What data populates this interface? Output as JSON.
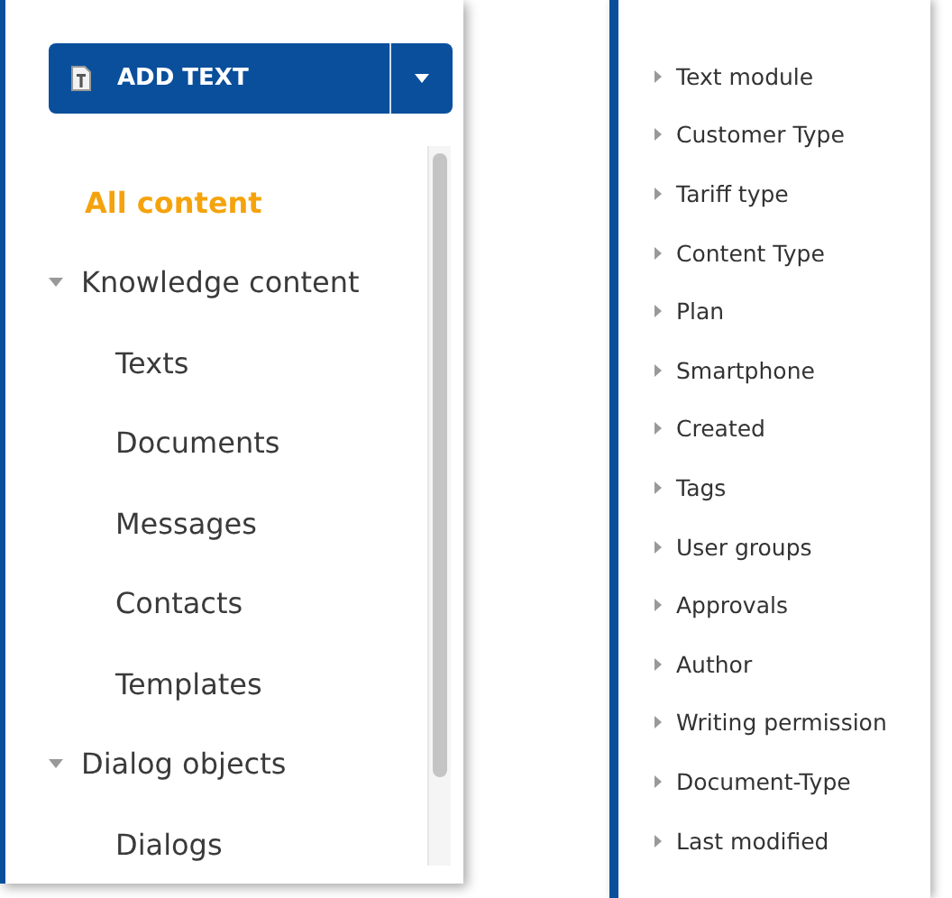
{
  "add_button": {
    "label": "ADD TEXT"
  },
  "tree": [
    {
      "label": "All content",
      "selected": true
    },
    {
      "label": "Knowledge content",
      "selected": false,
      "expanded": true,
      "children": [
        {
          "label": "Texts",
          "selected": false
        },
        {
          "label": "Documents",
          "selected": false
        },
        {
          "label": "Messages",
          "selected": false
        },
        {
          "label": "Contacts",
          "selected": false
        },
        {
          "label": "Templates",
          "selected": false
        }
      ]
    },
    {
      "label": "Dialog objects",
      "selected": false,
      "expanded": true,
      "children": [
        {
          "label": "Dialogs",
          "selected": false
        }
      ]
    }
  ],
  "filters": [
    {
      "label": "Text module",
      "expanded": false
    },
    {
      "label": "Customer Type",
      "expanded": false
    },
    {
      "label": "Tariff type",
      "expanded": false
    },
    {
      "label": "Content Type",
      "expanded": false
    },
    {
      "label": "Plan",
      "expanded": false
    },
    {
      "label": "Smartphone",
      "expanded": false
    },
    {
      "label": "Created",
      "expanded": false
    },
    {
      "label": "Tags",
      "expanded": false
    },
    {
      "label": "User groups",
      "expanded": false
    },
    {
      "label": "Approvals",
      "expanded": false
    },
    {
      "label": "Author",
      "expanded": false
    },
    {
      "label": "Writing permission",
      "expanded": false
    },
    {
      "label": "Document-Type",
      "expanded": false
    },
    {
      "label": "Last modified",
      "expanded": false
    }
  ]
}
